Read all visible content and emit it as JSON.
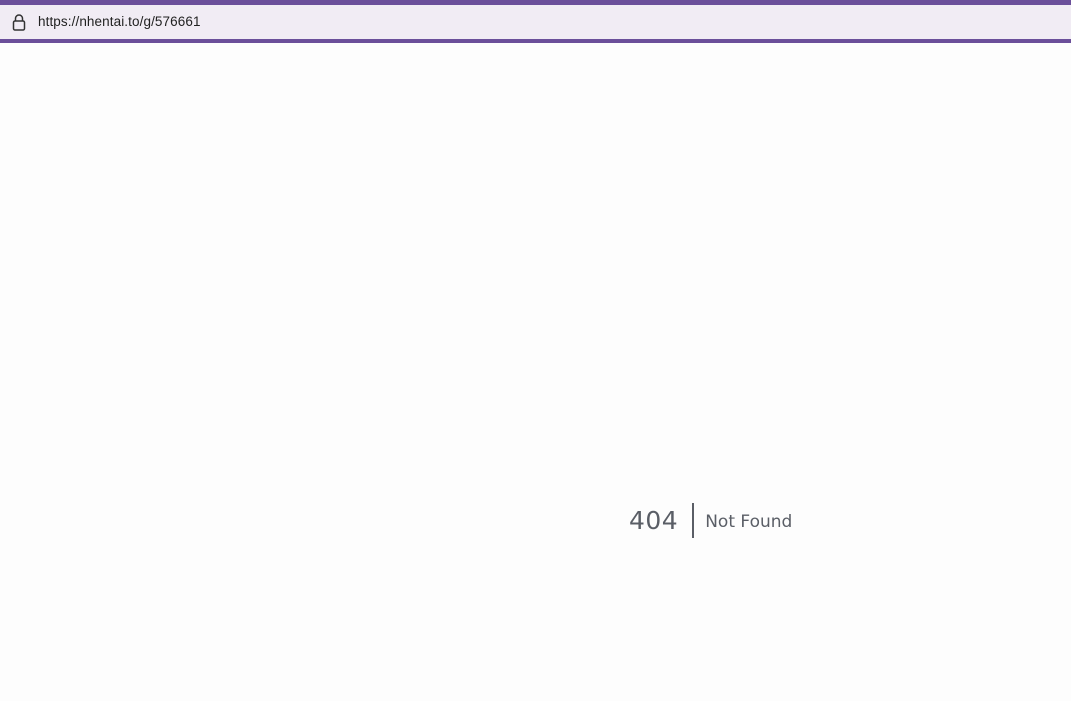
{
  "browser": {
    "url": "https://nhentai.to/g/576661",
    "lock_icon": "lock-icon",
    "accent_color": "#6b4f9a"
  },
  "error": {
    "code": "404",
    "message": "Not Found"
  }
}
